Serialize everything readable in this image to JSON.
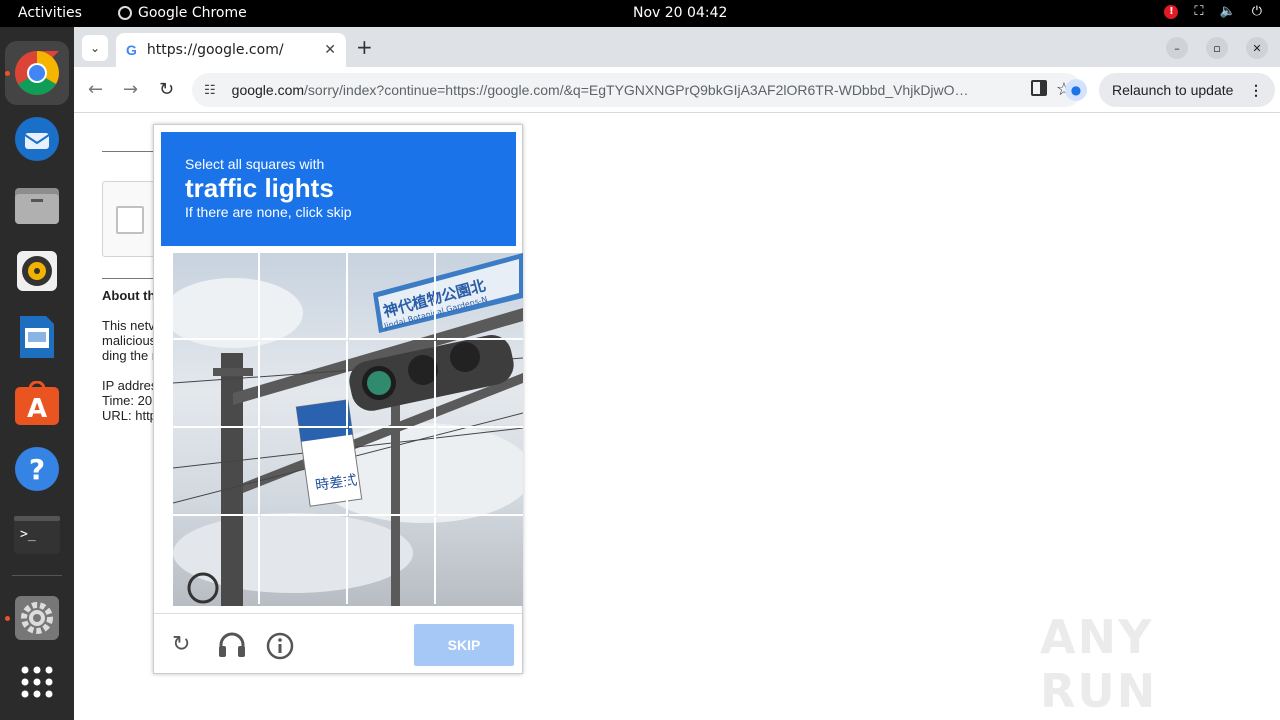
{
  "topbar": {
    "activities": "Activities",
    "app_name": "Google Chrome",
    "clock": "Nov 20  04:42",
    "alert_badge": "!",
    "icons": [
      "network-icon",
      "volume-icon",
      "power-icon"
    ]
  },
  "dock": {
    "apps": [
      "chrome-icon",
      "thunderbird-icon",
      "files-icon",
      "rhythmbox-icon",
      "writer-icon",
      "appcenter-icon",
      "help-icon",
      "terminal-icon",
      "settings-icon",
      "app-grid-icon"
    ]
  },
  "browser": {
    "tab_title": "https://google.com/",
    "tab_favicon": "G",
    "url_host": "google.com",
    "url_path": "/sorry/index?continue=https://google.com/&q=EgTYGNXNGPrQ9bkGIjA3AF2lOR6TR-WDbbd_VhjkDjwO…",
    "relaunch_label": "Relaunch to update"
  },
  "page": {
    "about_heading": "About th",
    "para_lines": [
      "This netv",
      "malicious",
      "ding the r"
    ],
    "info_lines": [
      "IP addres",
      "Time: 20",
      "URL: http"
    ]
  },
  "captcha": {
    "line1": "Select all squares with",
    "target": "traffic lights",
    "line3": "If there are none, click skip",
    "sign_text": "神代植物公園北",
    "sign_sub": "Jindai Botanical Gardens-N",
    "small_sign": "時差式",
    "skip_label": "SKIP"
  },
  "watermark": "ANY RUN",
  "colors": {
    "header_blue": "#1a73e8",
    "skip_disabled": "#a5c8f7"
  }
}
